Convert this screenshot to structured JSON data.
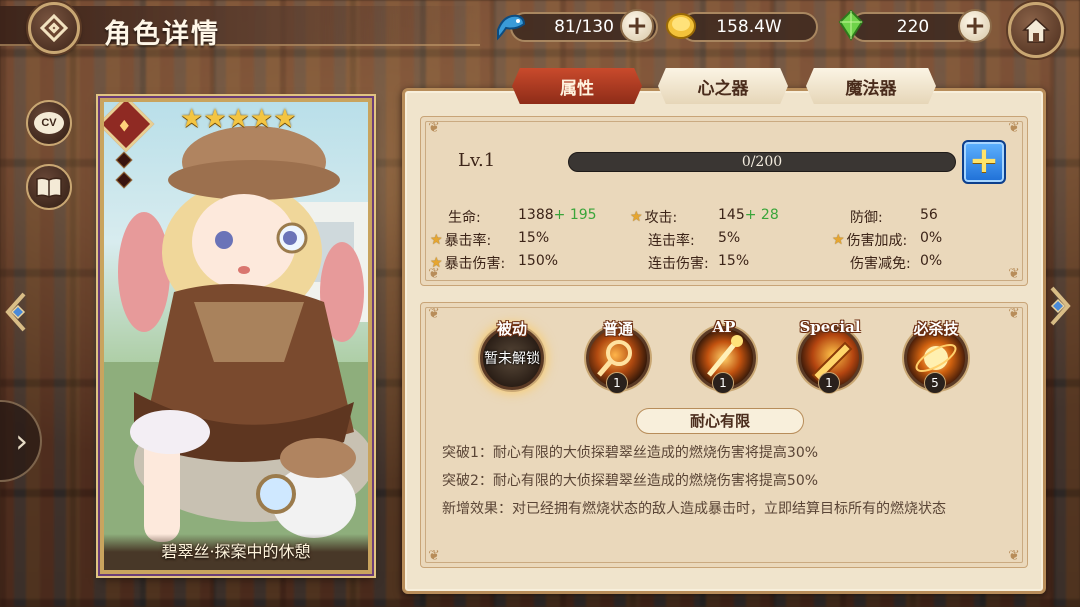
{
  "header": {
    "title": "角色详情",
    "resources": [
      {
        "icon": "fish-icon",
        "value": "81/130"
      },
      {
        "icon": "gold-coin-icon",
        "value": "158.4W"
      },
      {
        "icon": "green-crystal-icon",
        "value": "220"
      }
    ]
  },
  "sidebar": {
    "cv_label": "CV"
  },
  "card": {
    "name": "碧翠丝·探案中的休憩",
    "stars": [
      "★",
      "★",
      "★",
      "★",
      "★"
    ],
    "star_count": 5,
    "element": "fire"
  },
  "tabs": [
    {
      "label": "属性",
      "active": true
    },
    {
      "label": "心之器",
      "active": false
    },
    {
      "label": "魔法器",
      "active": false
    }
  ],
  "level": {
    "label": "Lv.1",
    "exp_text": "0/200",
    "exp_progress": 0,
    "level_up_symbol": "+"
  },
  "stats": [
    {
      "label": "生命:",
      "value": "1388",
      "bonus": "+ 195",
      "star": false
    },
    {
      "label": "攻击:",
      "value": "145",
      "bonus": "+ 28",
      "star": true
    },
    {
      "label": "防御:",
      "value": "56",
      "bonus": "",
      "star": false
    },
    {
      "label": "暴击率:",
      "value": "15%",
      "bonus": "",
      "star": true
    },
    {
      "label": "连击率:",
      "value": "5%",
      "bonus": "",
      "star": false
    },
    {
      "label": "伤害加成:",
      "value": "0%",
      "bonus": "",
      "star": true
    },
    {
      "label": "暴击伤害:",
      "value": "150%",
      "bonus": "",
      "star": true
    },
    {
      "label": "连击伤害:",
      "value": "15%",
      "bonus": "",
      "star": false
    },
    {
      "label": "伤害减免:",
      "value": "0%",
      "bonus": "",
      "star": false
    }
  ],
  "skills": [
    {
      "label": "被动",
      "level": "",
      "locked_text": "暂未解锁"
    },
    {
      "label": "普通",
      "level": "1"
    },
    {
      "label": "AP",
      "level": "1"
    },
    {
      "label": "Special",
      "level": "1"
    },
    {
      "label": "必杀技",
      "level": "5"
    }
  ],
  "skill_detail": {
    "title": "耐心有限",
    "lines": [
      "突破1：耐心有限的大侦探碧翠丝造成的燃烧伤害将提高30%",
      "突破2：耐心有限的大侦探碧翠丝造成的燃烧伤害将提高50%",
      "新增效果：对已经拥有燃烧状态的敌人造成暴击时，立即结算目标所有的燃烧状态"
    ]
  },
  "colors": {
    "accent_gold": "#c9a773",
    "panel_bg": "#f0e4cc",
    "active_tab": "#c94a2c",
    "bonus_green": "#3aa53a",
    "level_up_blue": "#1e6fd6"
  }
}
